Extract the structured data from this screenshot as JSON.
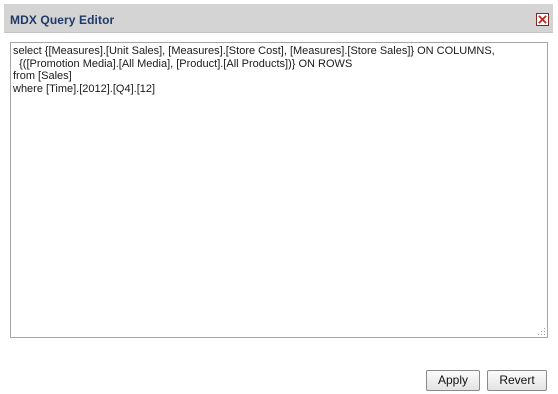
{
  "dialog": {
    "title": "MDX Query Editor",
    "close_icon": "close-icon",
    "close_color": "#c0281c"
  },
  "editor": {
    "query": "select {[Measures].[Unit Sales], [Measures].[Store Cost], [Measures].[Store Sales]} ON COLUMNS,\n  {([Promotion Media].[All Media], [Product].[All Products])} ON ROWS\nfrom [Sales]\nwhere [Time].[2012].[Q4].[12]"
  },
  "buttons": {
    "apply_label": "Apply",
    "revert_label": "Revert"
  }
}
